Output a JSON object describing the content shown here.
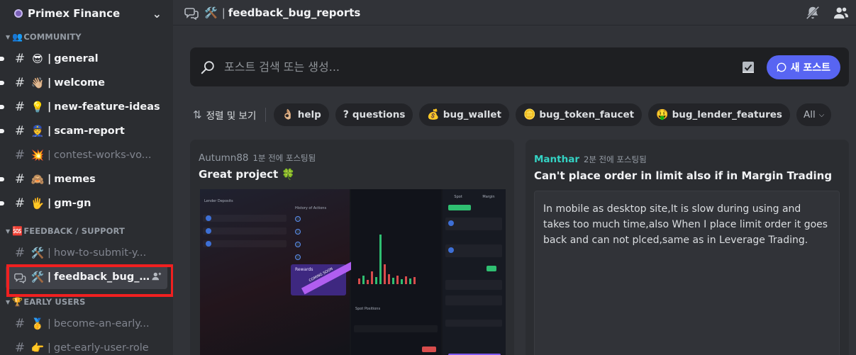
{
  "server": {
    "name": "Primex Finance"
  },
  "sidebar": {
    "categories": {
      "community": "COMMUNITY",
      "feedback": "FEEDBACK / SUPPORT",
      "early_users": "EARLY USERS"
    },
    "category_emoji": {
      "community": "👥",
      "feedback": "🆘",
      "early_users": "🏆"
    },
    "channels": [
      {
        "emoji": "😎",
        "label": "general"
      },
      {
        "emoji": "👋🏼",
        "label": "welcome"
      },
      {
        "emoji": "💡",
        "label": "new-feature-ideas"
      },
      {
        "emoji": "👮",
        "label": "scam-report"
      },
      {
        "emoji": "💥",
        "label": "contest-works-vo..."
      },
      {
        "emoji": "🙈",
        "label": "memes"
      },
      {
        "emoji": "🖐️",
        "label": "gm-gn"
      },
      {
        "emoji": "🛠️",
        "label": "how-to-submit-y..."
      },
      {
        "emoji": "🛠️",
        "label": "feedback_bug_r..."
      },
      {
        "emoji": "🥇",
        "label": "become-an-early..."
      },
      {
        "emoji": "👉",
        "label": "get-early-user-role"
      }
    ]
  },
  "topbar": {
    "emoji": "🛠️",
    "channel_name": "feedback_bug_reports"
  },
  "search": {
    "placeholder": "포스트 검색 또는 생성...",
    "new_post_label": "새 포스트"
  },
  "tags": {
    "sort_label": "정렬 및 보기",
    "items": [
      {
        "emoji": "👌🏼",
        "label": "help"
      },
      {
        "emoji": "?",
        "label": "questions"
      },
      {
        "emoji": "💰",
        "label": "bug_wallet"
      },
      {
        "emoji": "🪙",
        "label": "bug_token_faucet"
      },
      {
        "emoji": "🤑",
        "label": "bug_lender_features"
      }
    ],
    "all_label": "All"
  },
  "posts": [
    {
      "author": "Autumn88",
      "time": "1분 전에 포스팅됨",
      "title": "Great project 🍀",
      "preview": {
        "lender_deposits": "Lender Deposits",
        "history": "History of Actions",
        "rewards": "Rewards",
        "coming_soon": "COMING SOON",
        "spot_positions": "Spot Positions",
        "spot": "Spot",
        "margin": "Margin"
      }
    },
    {
      "author": "Manthar",
      "time": "2분 전에 포스팅됨",
      "title": "Can't place order in limit also if in Margin Trading",
      "body": "In mobile as desktop site,It is slow during using and takes too much time,also When I place limit order it goes back and can not plced,same as in Leverage Trading."
    }
  ],
  "colors": {
    "accent": "#5865f2",
    "highlight": "#f02020",
    "author_highlight": "#34d3c4"
  }
}
